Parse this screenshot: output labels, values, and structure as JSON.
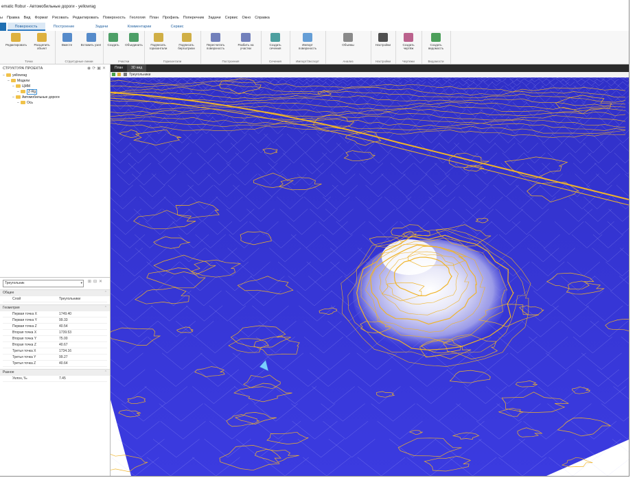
{
  "window": {
    "title": "ematic Robur - Автомобильные дороги - yellowrag"
  },
  "menu": [
    "ы",
    "Правка",
    "Вид",
    "Формат",
    "Рисовать",
    "Редактировать",
    "Поверхность",
    "Геология",
    "План",
    "Профиль",
    "Поперечник",
    "Задачи",
    "Сервис",
    "Окно",
    "Справка"
  ],
  "ribbon_tabs": [
    {
      "label": "Поверхность",
      "active": true
    },
    {
      "label": "Построение",
      "active": false
    },
    {
      "label": "Задачи",
      "active": false
    },
    {
      "label": "Комментарии",
      "active": false
    },
    {
      "label": "Сервис",
      "active": false
    }
  ],
  "ribbon_groups": [
    {
      "label": "Точки",
      "buttons": [
        "Редактировать",
        "Расщепить объект"
      ]
    },
    {
      "label": "Структурные линии",
      "buttons": [
        "Вместе",
        "Вставить узел"
      ]
    },
    {
      "label": "Участки",
      "buttons": [
        "Создать",
        "Объединить"
      ]
    },
    {
      "label": "Горизонтали",
      "buttons": [
        "Подписать горизонтали",
        "Подписать бергштрихи"
      ]
    },
    {
      "label": "Построения",
      "buttons": [
        "Пересчитать поверхность",
        "Разбить на участки"
      ]
    },
    {
      "label": "Сечения",
      "buttons": [
        "Создать сечения"
      ]
    },
    {
      "label": "Импорт/Экспорт",
      "buttons": [
        "Импорт поверхность"
      ]
    },
    {
      "label": "Анализ",
      "buttons": [
        "Объемы"
      ]
    },
    {
      "label": "Настройки",
      "buttons": [
        "Настройки"
      ]
    },
    {
      "label": "Чертежи",
      "buttons": [
        "Создать чертёж"
      ]
    },
    {
      "label": "Ведомости",
      "buttons": [
        "Создать ведомость"
      ]
    }
  ],
  "project_panel": {
    "title": "СТРУКТУРА ПРОЕКТА",
    "tree": [
      {
        "label": "yellowrag",
        "level": 0
      },
      {
        "label": "Модели",
        "level": 1
      },
      {
        "label": "ЦММ",
        "level": 2
      },
      {
        "label": "Z-Rg",
        "level": 3,
        "selected": true
      },
      {
        "label": "Автомобильные дороги",
        "level": 2
      },
      {
        "label": "Ось",
        "level": 3
      }
    ]
  },
  "properties": {
    "selector": "Треугольник",
    "sections": [
      {
        "title": "Общее",
        "rows": [
          {
            "name": "Слой",
            "value": "Треугольники"
          }
        ]
      },
      {
        "title": "Геометрия",
        "rows": [
          {
            "name": "Первая точка X",
            "value": "1749.40"
          },
          {
            "name": "Первая точка Y",
            "value": "99.33"
          },
          {
            "name": "Первая точка Z",
            "value": "40.54"
          },
          {
            "name": "Вторая точка X",
            "value": "1739.53"
          },
          {
            "name": "Вторая точка Y",
            "value": "75.00"
          },
          {
            "name": "Вторая точка Z",
            "value": "40.67"
          },
          {
            "name": "Третья точка X",
            "value": "1734.16"
          },
          {
            "name": "Третья точка Y",
            "value": "99.27"
          },
          {
            "name": "Третья точка Z",
            "value": "40.64"
          }
        ]
      },
      {
        "title": "Разное",
        "rows": [
          {
            "name": "Уклон, ‰",
            "value": "7.45"
          }
        ]
      }
    ]
  },
  "view": {
    "tabs": [
      {
        "label": "План",
        "active": false
      },
      {
        "label": "3D вид",
        "active": true
      }
    ],
    "layer_label": "Треугольники",
    "colors": {
      "terrain": "#3a3ad8",
      "contour": "#f0b429",
      "mesh": "#c8c8ff",
      "hill": "#ffffff"
    }
  }
}
